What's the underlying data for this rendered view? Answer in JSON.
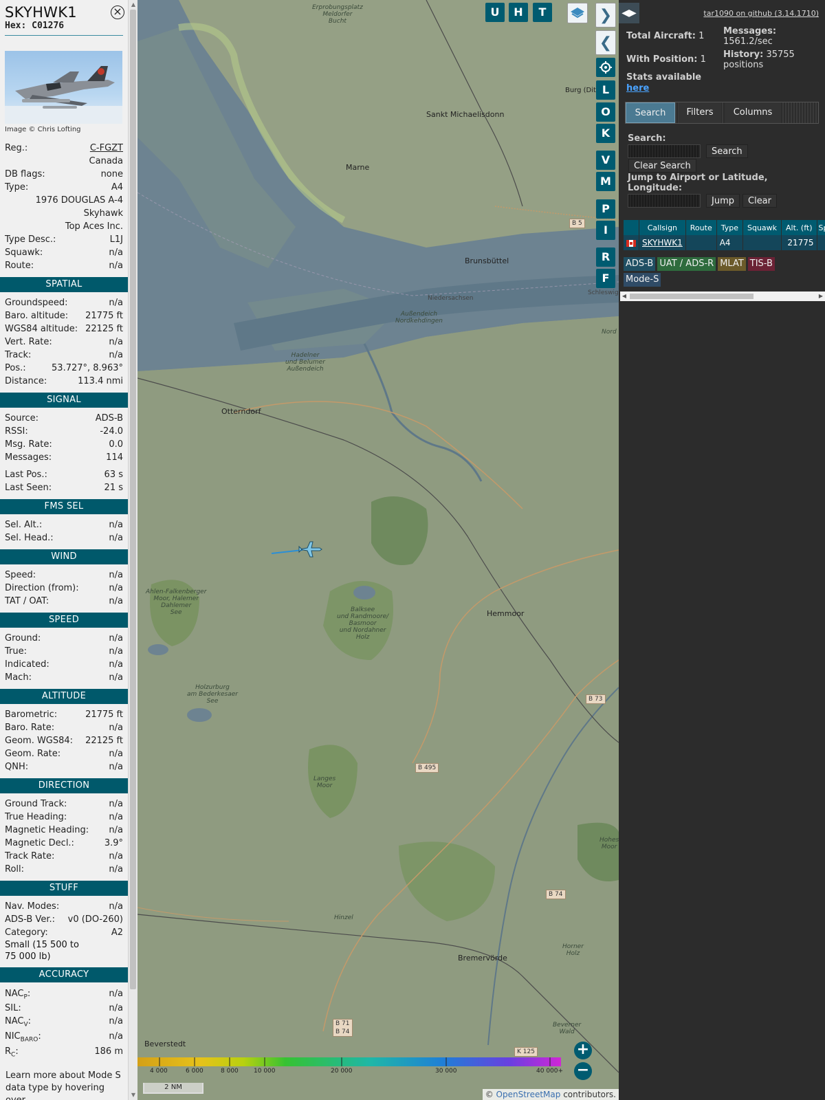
{
  "aircraft": {
    "callsign": "SKYHWK1",
    "hex_label": "Hex:",
    "hex": "C01276",
    "photo_credit": "Image © Chris Lofting",
    "reg_label": "Reg.:",
    "reg": "C-FGZT",
    "country": "Canada",
    "dbflags_label": "DB flags:",
    "dbflags": "none",
    "type_label": "Type:",
    "type": "A4",
    "model_line1": "1976 DOUGLAS A-4",
    "model_line2": "Skyhawk",
    "operator": "Top Aces Inc.",
    "typedesc_label": "Type Desc.:",
    "typedesc": "L1J",
    "squawk_label": "Squawk:",
    "squawk": "n/a",
    "route_label": "Route:",
    "route": "n/a"
  },
  "sections": {
    "spatial": {
      "title": "SPATIAL",
      "rows": [
        {
          "label": "Groundspeed:",
          "value": "n/a"
        },
        {
          "label": "Baro. altitude:",
          "value": "21775 ft"
        },
        {
          "label": "WGS84 altitude:",
          "value": "22125 ft"
        },
        {
          "label": "Vert. Rate:",
          "value": "n/a"
        },
        {
          "label": "Track:",
          "value": "n/a"
        },
        {
          "label": "Pos.:",
          "value": "53.727°, 8.963°"
        },
        {
          "label": "Distance:",
          "value": "113.4 nmi"
        }
      ]
    },
    "signal": {
      "title": "SIGNAL",
      "rows": [
        {
          "label": "Source:",
          "value": "ADS-B"
        },
        {
          "label": "RSSI:",
          "value": "-24.0"
        },
        {
          "label": "Msg. Rate:",
          "value": "0.0"
        },
        {
          "label": "Messages:",
          "value": "114"
        }
      ],
      "rows2": [
        {
          "label": "Last Pos.:",
          "value": "63 s"
        },
        {
          "label": "Last Seen:",
          "value": "21 s"
        }
      ]
    },
    "fms": {
      "title": "FMS SEL",
      "rows": [
        {
          "label": "Sel. Alt.:",
          "value": "n/a"
        },
        {
          "label": "Sel. Head.:",
          "value": "n/a"
        }
      ]
    },
    "wind": {
      "title": "WIND",
      "rows": [
        {
          "label": "Speed:",
          "value": "n/a"
        },
        {
          "label": "Direction (from):",
          "value": "n/a"
        },
        {
          "label": "TAT / OAT:",
          "value": "n/a"
        }
      ]
    },
    "speed": {
      "title": "SPEED",
      "rows": [
        {
          "label": "Ground:",
          "value": "n/a"
        },
        {
          "label": "True:",
          "value": "n/a"
        },
        {
          "label": "Indicated:",
          "value": "n/a"
        },
        {
          "label": "Mach:",
          "value": "n/a"
        }
      ]
    },
    "altitude": {
      "title": "ALTITUDE",
      "rows": [
        {
          "label": "Barometric:",
          "value": "21775 ft"
        },
        {
          "label": "Baro. Rate:",
          "value": "n/a"
        },
        {
          "label": "Geom. WGS84:",
          "value": "22125 ft"
        },
        {
          "label": "Geom. Rate:",
          "value": "n/a"
        },
        {
          "label": "QNH:",
          "value": "n/a"
        }
      ]
    },
    "direction": {
      "title": "DIRECTION",
      "rows": [
        {
          "label": "Ground Track:",
          "value": "n/a"
        },
        {
          "label": "True Heading:",
          "value": "n/a"
        },
        {
          "label": "Magnetic Heading:",
          "value": "n/a"
        },
        {
          "label": "Magnetic Decl.:",
          "value": "3.9°"
        },
        {
          "label": "Track Rate:",
          "value": "n/a"
        },
        {
          "label": "Roll:",
          "value": "n/a"
        }
      ]
    },
    "stuff": {
      "title": "STUFF",
      "rows": [
        {
          "label": "Nav. Modes:",
          "value": "n/a"
        },
        {
          "label": "ADS-B Ver.:",
          "value": "v0 (DO-260)"
        },
        {
          "label": "Category:",
          "value": "A2"
        }
      ],
      "category_desc_1": "Small (15 500 to",
      "category_desc_2": "75 000 lb)"
    },
    "accuracy": {
      "title": "ACCURACY",
      "nacp": "NAC",
      "nacp_sub": "P",
      "nacp_value": "n/a",
      "sil": "SIL:",
      "sil_value": "n/a",
      "nacv": "NAC",
      "nacv_sub": "V",
      "nacv_value": "n/a",
      "nicbaro": "NIC",
      "nicbaro_sub": "BARO",
      "nicbaro_value": "n/a",
      "rc": "R",
      "rc_sub": "C",
      "rc_value": "186 m"
    },
    "footer_1": "Learn more about Mode S",
    "footer_2": "data type by hovering over"
  },
  "map": {
    "labels": {
      "erprobung": "Erprobungsplatz",
      "meldorfer": "Meldorfer",
      "bucht": "Bucht",
      "burg": "Burg (Dit",
      "sankt": "Sankt Michaelisdonn",
      "marne": "Marne",
      "brunsbuttel": "Brunsbüttel",
      "niedersachsen": "Niedersachsen",
      "schleswig": "Schleswig",
      "aussendeich": "Außendeich",
      "nordkehdingen": "Nordkehdingen",
      "nord": "Nord",
      "hadelner1": "Hadelner",
      "hadelner2": "und Belumer",
      "hadelner3": "Außendeich",
      "otterndorf": "Otterndorf",
      "ahlen1": "Ahlen-Falkenberger",
      "ahlen2": "Moor, Halemer",
      "ahlen3": "Dahlemer",
      "ahlen4": "See",
      "balksee1": "Balksee",
      "balksee2": "und Randmoore/",
      "balksee3": "Basmoor",
      "balksee4": "und Nordahner",
      "balksee5": "Holz",
      "hemmoor": "Hemmoor",
      "holzurburg1": "Holzurburg",
      "holzurburg2": "am Bederkesaer",
      "holzurburg3": "See",
      "langes1": "Langes",
      "langes2": "Moor",
      "hohes1": "Hohes",
      "hohes2": "Moor",
      "hinzel": "Hinzel",
      "horner1": "Horner",
      "horner2": "Holz",
      "bremervorde": "Bremervörde",
      "beverner1": "Beverner",
      "beverner2": "Wald",
      "beverstedt": "Beverstedt"
    },
    "roads": {
      "b5": "B 5",
      "b73": "B 73",
      "b495": "B 495",
      "b74": "B 74",
      "b71": "B 71",
      "b74b": "B 74",
      "k125": "K 125"
    },
    "buttons": {
      "u": "U",
      "h": "H",
      "t": "T",
      "l": "L",
      "o": "O",
      "k": "K",
      "v": "V",
      "m": "M",
      "p": "P",
      "i": "I",
      "r": "R",
      "f": "F",
      "zoom_in": "+",
      "zoom_out": "−"
    },
    "legend": {
      "labels": [
        "4 000",
        "6 000",
        "8 000",
        "10 000",
        "20 000",
        "30 000",
        "40 000+"
      ]
    },
    "scale": "2 NM",
    "credit_prefix": "© ",
    "credit_link": "OpenStreetMap",
    "credit_suffix": " contributors."
  },
  "right": {
    "github": "tar1090 on github (3.14.1710)",
    "total_label": "Total Aircraft:",
    "total": "1",
    "with_pos_label": "With Position:",
    "with_pos": "1",
    "stats_label": "Stats available",
    "stats_link": "here",
    "messages_label": "Messages:",
    "messages": "1561.2/sec",
    "history_label": "History:",
    "history": "35755",
    "history_unit": "positions",
    "tabs": [
      "Search",
      "Filters",
      "Columns"
    ],
    "search_label": "Search:",
    "search_btn": "Search",
    "clear_search_btn": "Clear Search",
    "jump_label_1": "Jump to Airport or Latitude,",
    "jump_label_2": "Longitude:",
    "jump_btn": "Jump",
    "clear_btn": "Clear",
    "table": {
      "headers": [
        "",
        "Callsign",
        "Route",
        "Type",
        "Squawk",
        "Alt. (ft)",
        "Sp"
      ],
      "row": {
        "callsign": "SKYHWK1",
        "route": "",
        "type": "A4",
        "squawk": "",
        "alt": "21775",
        "sp": ""
      }
    },
    "sources": [
      {
        "label": "ADS-B",
        "color": "#1f4f63"
      },
      {
        "label": "UAT / ADS-R",
        "color": "#2e6b3d"
      },
      {
        "label": "MLAT",
        "color": "#6b5a2a"
      },
      {
        "label": "TIS-B",
        "color": "#6b2235"
      },
      {
        "label": "Mode-S",
        "color": "#2f4b66"
      }
    ]
  }
}
